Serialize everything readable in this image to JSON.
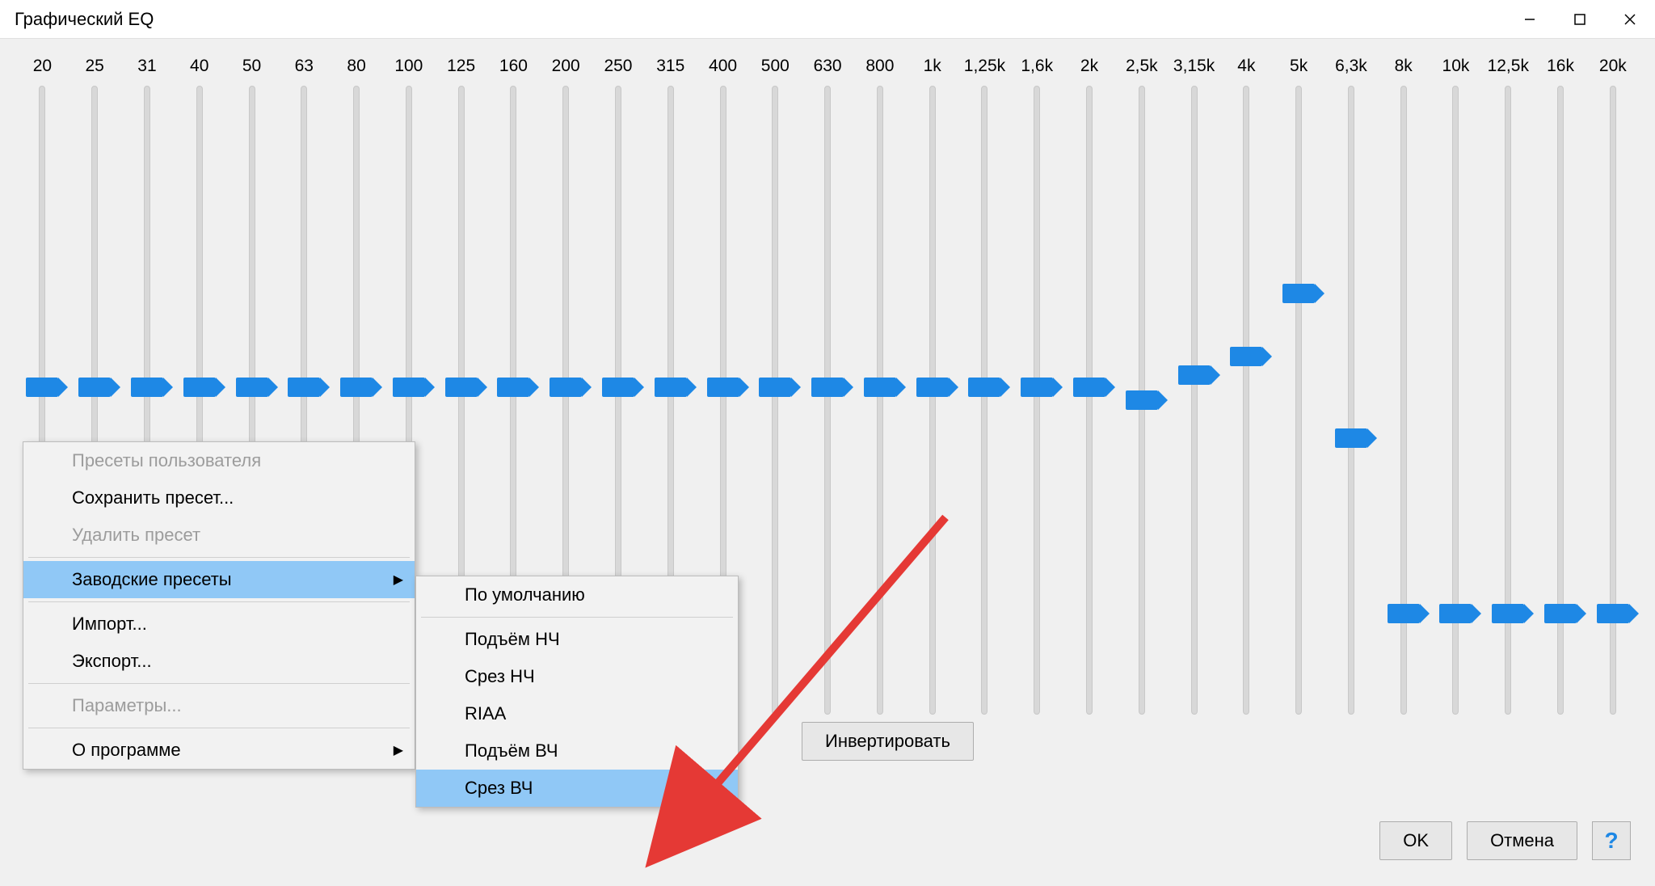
{
  "window": {
    "title": "Графический EQ"
  },
  "frequencies": [
    "20",
    "25",
    "31",
    "40",
    "50",
    "63",
    "80",
    "100",
    "125",
    "160",
    "200",
    "250",
    "315",
    "400",
    "500",
    "630",
    "800",
    "1k",
    "1,25k",
    "1,6k",
    "2k",
    "2,5k",
    "3,15k",
    "4k",
    "5k",
    "6,3k",
    "8k",
    "10k",
    "12,5k",
    "16k",
    "20k"
  ],
  "slider_positions_pct": [
    48,
    48,
    48,
    48,
    48,
    48,
    48,
    48,
    48,
    48,
    48,
    48,
    48,
    48,
    48,
    48,
    48,
    48,
    48,
    48,
    48,
    50,
    46,
    43,
    33,
    56,
    84,
    84,
    84,
    84,
    84
  ],
  "menu1": {
    "items": [
      {
        "label": "Пресеты пользователя",
        "disabled": true
      },
      {
        "label": "Сохранить пресет..."
      },
      {
        "label": "Удалить пресет",
        "disabled": true
      },
      {
        "sep": true
      },
      {
        "label": "Заводские пресеты",
        "submenu": true,
        "highlight": true
      },
      {
        "sep": true
      },
      {
        "label": "Импорт..."
      },
      {
        "label": "Экспорт..."
      },
      {
        "sep": true
      },
      {
        "label": "Параметры...",
        "disabled": true
      },
      {
        "sep": true
      },
      {
        "label": "О программе",
        "submenu": true
      }
    ]
  },
  "menu2": {
    "items": [
      {
        "label": "По умолчанию"
      },
      {
        "sep": true
      },
      {
        "label": "Подъём НЧ"
      },
      {
        "label": "Срез НЧ"
      },
      {
        "label": "RIAA"
      },
      {
        "label": "Подъём ВЧ"
      },
      {
        "label": "Срез ВЧ",
        "highlight": true
      }
    ]
  },
  "buttons": {
    "invert": "Инвертировать",
    "ok": "OK",
    "cancel": "Отмена"
  }
}
